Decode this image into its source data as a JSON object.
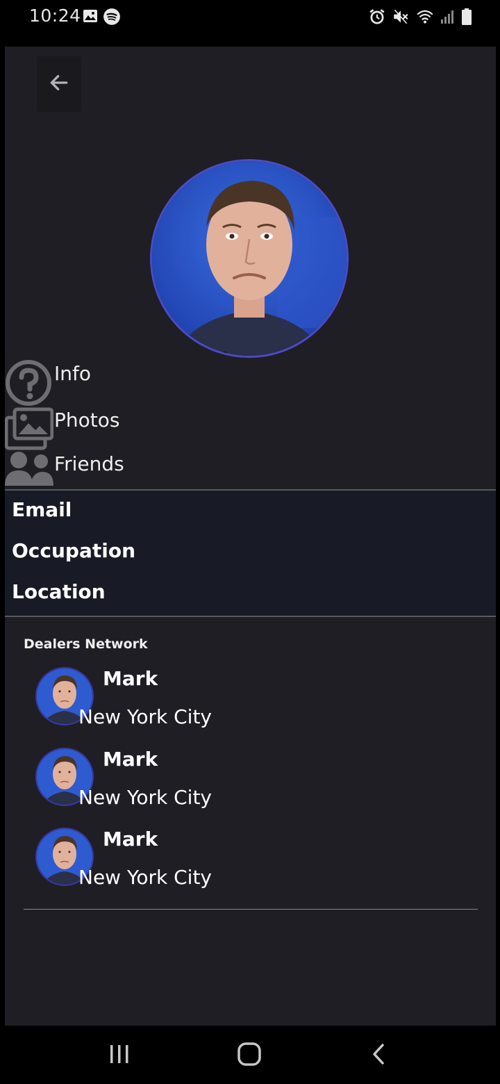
{
  "status_bar": {
    "time": "10:24",
    "left_icons": [
      "gallery-icon",
      "spotify-icon"
    ],
    "right_icons": [
      "alarm-icon",
      "mute-icon",
      "wifi-icon",
      "signal-icon",
      "battery-icon"
    ]
  },
  "header": {
    "back_icon": "arrow-left-icon"
  },
  "menu": {
    "items": [
      {
        "label": "Info",
        "icon": "help-circle-icon"
      },
      {
        "label": "Photos",
        "icon": "photos-icon"
      },
      {
        "label": "Friends",
        "icon": "friends-icon"
      }
    ]
  },
  "details": {
    "items": [
      {
        "label": "Email"
      },
      {
        "label": "Occupation"
      },
      {
        "label": "Location"
      }
    ]
  },
  "network": {
    "title": "Dealers Network",
    "items": [
      {
        "name": "Mark",
        "location": "New York City"
      },
      {
        "name": "Mark",
        "location": "New York City"
      },
      {
        "name": "Mark",
        "location": "New York City"
      }
    ]
  },
  "nav_bar": {
    "buttons": [
      "recents-icon",
      "home-icon",
      "back-icon"
    ]
  },
  "colors": {
    "app_background": "#1e1e24",
    "details_background": "#181b26",
    "avatar_border": "#4b4bc4",
    "icon_gray": "#6e6e72"
  }
}
